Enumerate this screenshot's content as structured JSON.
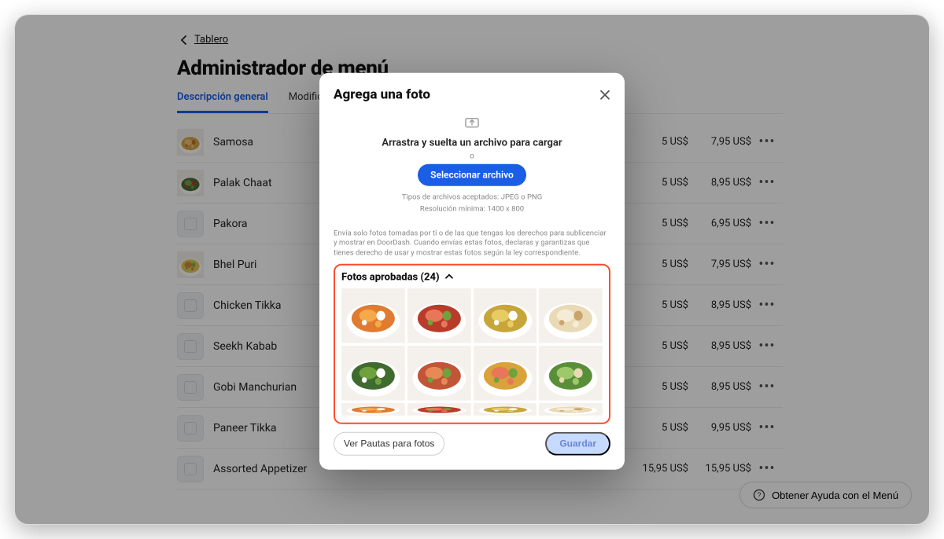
{
  "breadcrumb": {
    "label": "Tablero"
  },
  "page_title": "Administrador de menú",
  "tabs": [
    {
      "label": "Descripción general",
      "active": true
    },
    {
      "label": "Modificadores",
      "active": false
    }
  ],
  "menu_items": [
    {
      "name": "Samosa",
      "price1": "5 US$",
      "price2": "7,95 US$",
      "thumb": "samosa"
    },
    {
      "name": "Palak Chaat",
      "price1": "5 US$",
      "price2": "8,95 US$",
      "thumb": "palak"
    },
    {
      "name": "Pakora",
      "price1": "5 US$",
      "price2": "6,95 US$",
      "thumb": null
    },
    {
      "name": "Bhel Puri",
      "price1": "5 US$",
      "price2": "7,95 US$",
      "thumb": "bhel"
    },
    {
      "name": "Chicken Tikka",
      "price1": "5 US$",
      "price2": "8,95 US$",
      "thumb": null
    },
    {
      "name": "Seekh Kabab",
      "price1": "5 US$",
      "price2": "8,95 US$",
      "thumb": null
    },
    {
      "name": "Gobi Manchurian",
      "price1": "5 US$",
      "price2": "8,95 US$",
      "thumb": null
    },
    {
      "name": "Paneer Tikka",
      "price1": "5 US$",
      "price2": "9,95 US$",
      "thumb": null
    },
    {
      "name": "Assorted Appetizer",
      "price1": "15,95 US$",
      "price2": "15,95 US$",
      "thumb": null
    }
  ],
  "modal": {
    "title": "Agrega una foto",
    "drag_text": "Arrastra y suelta un archivo para cargar",
    "or": "o",
    "select_button": "Seleccionar archivo",
    "accepted": "Tipos de archivos aceptados: JPEG o PNG",
    "resolution": "Resolución mínima: 1400 x 800",
    "legal": "Envía solo fotos tomadas por ti o de las que tengas los derechos para sublicenciar y mostrar en DoorDash. Cuando envías estas fotos, declaras y garantizas que tienes derecho de usar y mostrar estas fotos según la ley correspondiente.",
    "approved_header": "Fotos aprobadas (24)",
    "guidelines_button": "Ver Pautas para fotos",
    "save_button": "Guardar",
    "tiles": [
      "soup-orange",
      "tandoori-red",
      "dal-yellow",
      "naan",
      "palak-greens",
      "chicken-peppers",
      "biryani-veg",
      "salad-green",
      "crop1",
      "crop2",
      "crop3",
      "crop4"
    ]
  },
  "help_button": "Obtener Ayuda con el Menú",
  "colors": {
    "accent": "#1a5ee6",
    "highlight_border": "#ff4b2b"
  }
}
